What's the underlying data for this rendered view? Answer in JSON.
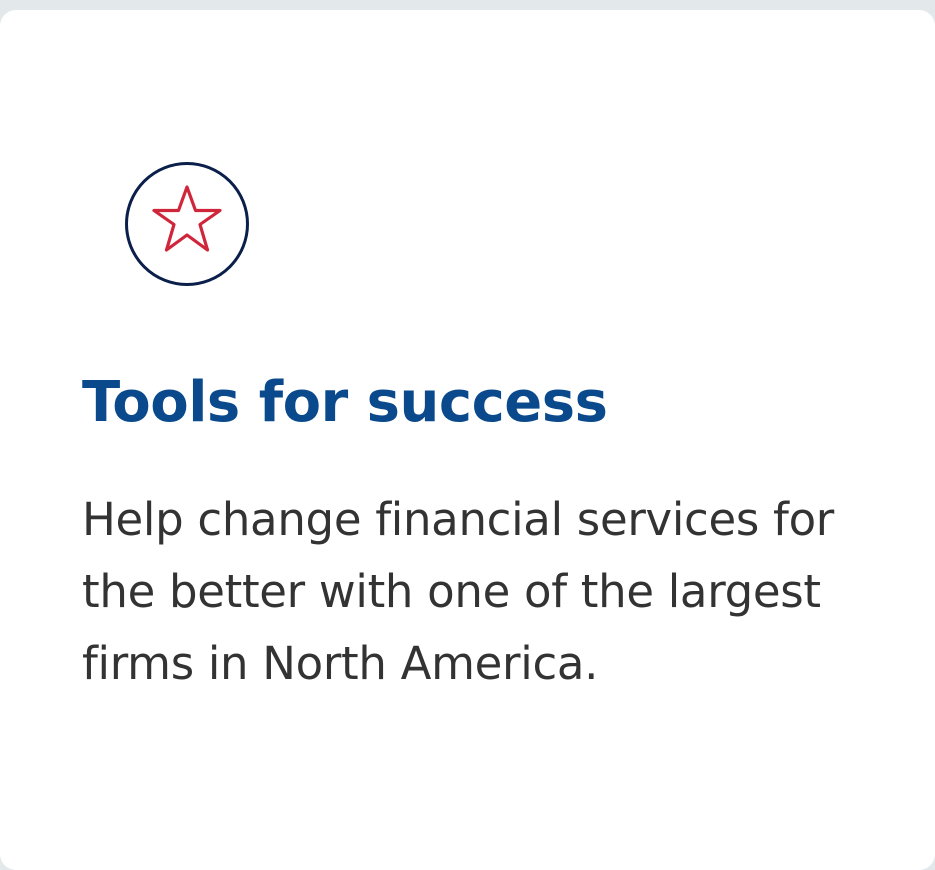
{
  "card": {
    "icon": "star-icon",
    "title": "Tools for success",
    "description": "Help change financial services for the better with one of the largest firms in North America."
  },
  "colors": {
    "title": "#0a4a8c",
    "icon_ring": "#0b1f4b",
    "icon_star": "#d0263b",
    "body_text": "#333333",
    "card_background": "#ffffff",
    "page_background": "#e3e8ea"
  }
}
